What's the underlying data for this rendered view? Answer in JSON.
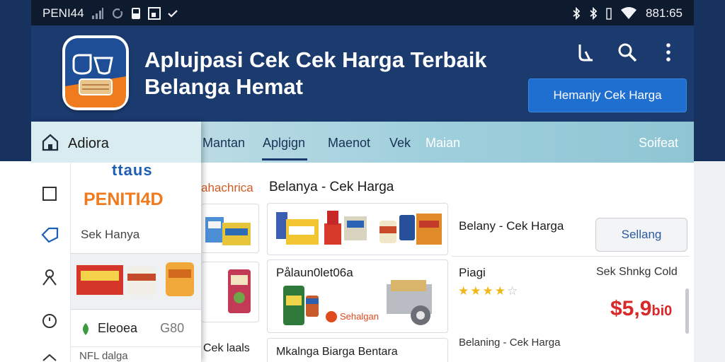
{
  "status_bar": {
    "carrier": "PENI44",
    "time": "881:65"
  },
  "header": {
    "title_line1": "Aplujpasi Cek Cek Harga Terbaik",
    "title_line2": "Belanga Hemat",
    "cta_button": "Hemanjy Cek Harga",
    "brand_color": "#1b3a6e",
    "accent_color": "#f07a1e"
  },
  "tabs": [
    {
      "label": "Mantan"
    },
    {
      "label": "Aplgign"
    },
    {
      "label": "Maenot"
    },
    {
      "label": "Vek"
    },
    {
      "label": "Maian"
    },
    {
      "label": "Soifeat"
    }
  ],
  "drawer": {
    "home_label": "Adiora",
    "brand_partial": "ttaus",
    "brand": "PENITI4D",
    "subtitle": "Sek Hanya",
    "footer_item": "Eleoea",
    "footer_value": "G80",
    "footer_cut": "NFL dalga"
  },
  "content": {
    "cut_text": "ahachrica",
    "section_title": "Belanya - Cek Harga",
    "side_card_label": "Cek laals",
    "card2_title": "Pålaun0let06a",
    "card2_badge": "Sehalgan",
    "card3_title": "Mkalnga Biarga Bentara",
    "product_title": "Belany - Cek Harga",
    "button": "Sellang",
    "product_label": "Piagi",
    "product_side": "Sek Shnkg Cold",
    "rating": 4,
    "rating_max": 5,
    "price": "$5,9",
    "price_suffix": "bi0",
    "bottom_label": "Belaning - Cek Harga"
  }
}
